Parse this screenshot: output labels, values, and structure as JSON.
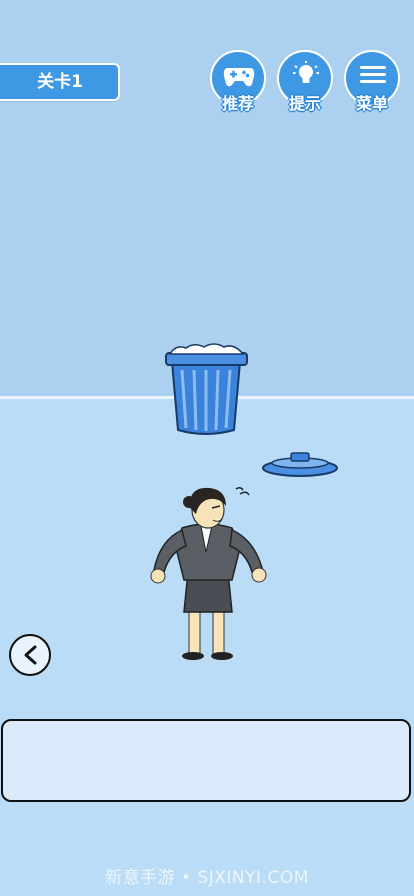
{
  "level": {
    "label": "关卡1"
  },
  "top_buttons": [
    {
      "label": "推荐",
      "icon": "gamepad-icon"
    },
    {
      "label": "提示",
      "icon": "lightbulb-icon"
    },
    {
      "label": "菜单",
      "icon": "menu-icon"
    }
  ],
  "scene": {
    "trash_can": "trash-can-full",
    "lid": "trash-can-lid",
    "character": "office-woman"
  },
  "back": {
    "icon": "chevron-left-icon"
  },
  "dialog": {
    "text": ""
  },
  "watermark": {
    "text": "新意手游 • SJXINYI.COM"
  },
  "colors": {
    "accent": "#3f98e3",
    "wall": "#acd1f0",
    "floor": "#badcf6"
  }
}
